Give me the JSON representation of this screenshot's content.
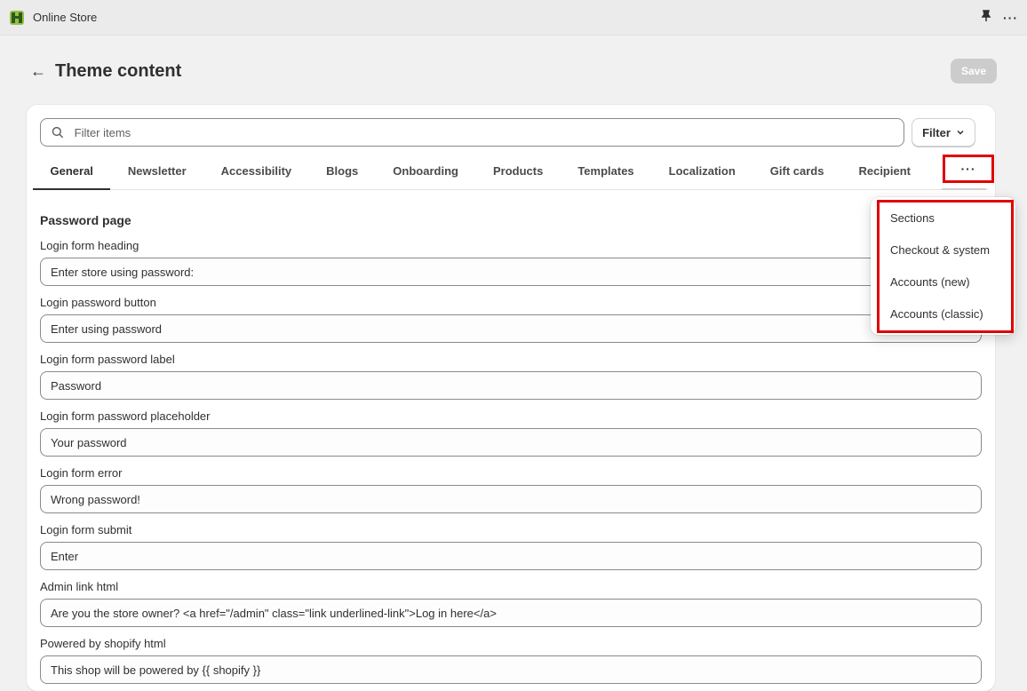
{
  "app": {
    "name": "Online Store"
  },
  "header": {
    "title": "Theme content",
    "save_label": "Save"
  },
  "search": {
    "placeholder": "Filter items",
    "filter_label": "Filter"
  },
  "tabs": [
    {
      "label": "General",
      "active": true
    },
    {
      "label": "Newsletter"
    },
    {
      "label": "Accessibility"
    },
    {
      "label": "Blogs"
    },
    {
      "label": "Onboarding"
    },
    {
      "label": "Products"
    },
    {
      "label": "Templates"
    },
    {
      "label": "Localization"
    },
    {
      "label": "Gift cards"
    },
    {
      "label": "Recipient"
    }
  ],
  "more_tab": {
    "label": "···"
  },
  "dropdown": {
    "items": [
      "Sections",
      "Checkout & system",
      "Accounts (new)",
      "Accounts (classic)"
    ]
  },
  "section": {
    "title": "Password page"
  },
  "fields": [
    {
      "label": "Login form heading",
      "value": "Enter store using password:"
    },
    {
      "label": "Login password button",
      "value": "Enter using password"
    },
    {
      "label": "Login form password label",
      "value": "Password"
    },
    {
      "label": "Login form password placeholder",
      "value": "Your password"
    },
    {
      "label": "Login form error",
      "value": "Wrong password!"
    },
    {
      "label": "Login form submit",
      "value": "Enter"
    },
    {
      "label": "Admin link html",
      "value": "Are you the store owner? <a href=\"/admin\" class=\"link underlined-link\">Log in here</a>"
    },
    {
      "label": "Powered by shopify html",
      "value": "This shop will be powered by {{ shopify }}"
    }
  ],
  "colors": {
    "highlight": "#e00000",
    "brand_green": "#5a8b2f"
  }
}
